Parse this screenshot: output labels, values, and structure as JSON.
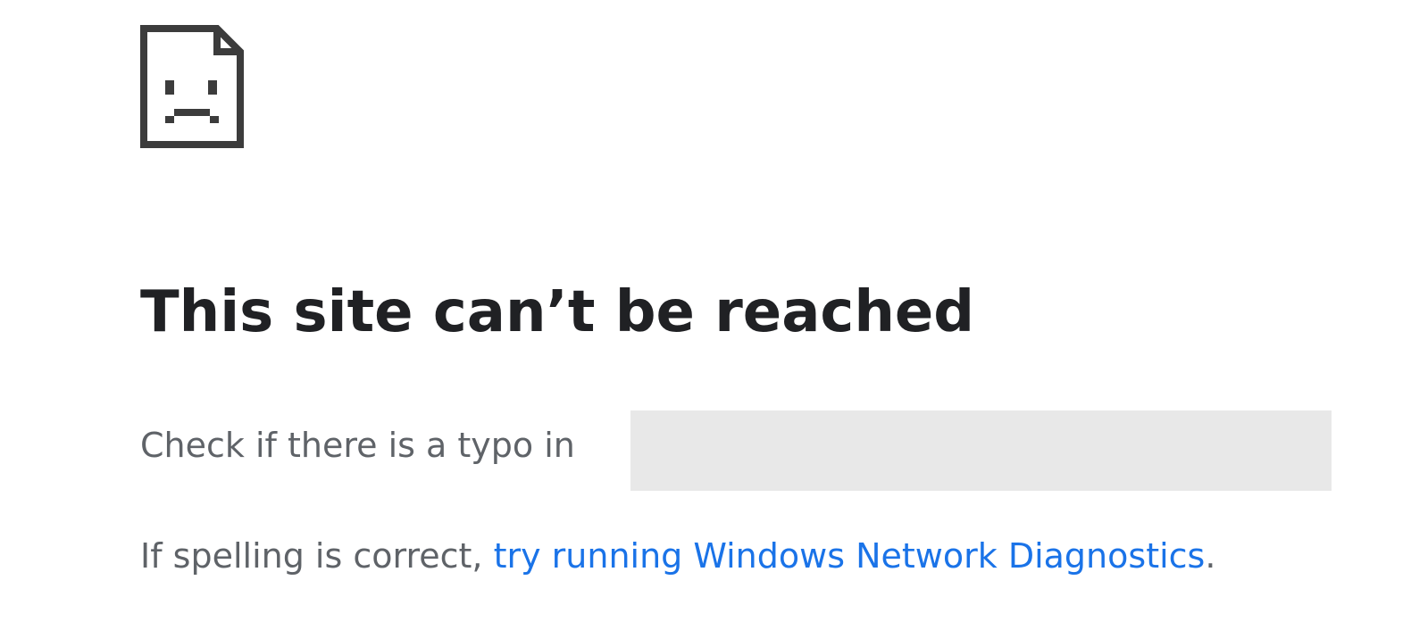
{
  "error_page": {
    "icon": "sad-page-icon",
    "title": "This site can’t be reached",
    "typo_hint": "Check if there is a typo in",
    "spelling_prefix": "If spelling is correct, ",
    "diagnostics_link": "try running Windows Network Diagnostics",
    "spelling_suffix": "."
  },
  "colors": {
    "title": "#202124",
    "body_text": "#5f6368",
    "link": "#1a73e8",
    "redaction": "#e8e8e8",
    "icon": "#3c3c3c"
  }
}
